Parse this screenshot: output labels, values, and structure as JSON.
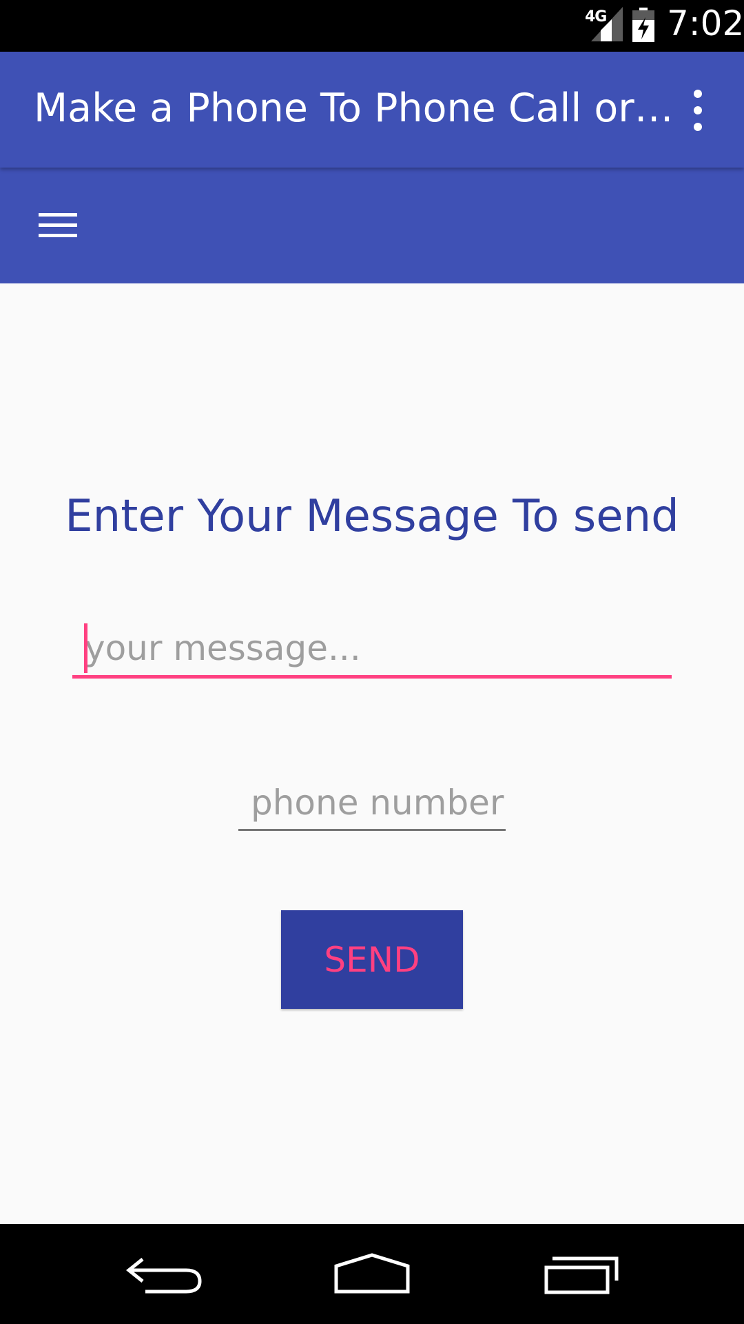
{
  "status_bar": {
    "network": "4G",
    "time": "7:02",
    "signal_icon": "signal-icon",
    "battery_icon": "battery-charging-icon"
  },
  "app_bar": {
    "title": "Make a Phone To Phone Call or…",
    "overflow_icon": "more-vert-icon"
  },
  "toolbar": {
    "menu_icon": "hamburger-menu-icon"
  },
  "content": {
    "heading": "Enter Your Message To send",
    "message_placeholder": "your message...",
    "phone_placeholder": "phone number",
    "send_label": "SEND"
  },
  "nav_bar": {
    "back_icon": "back-icon",
    "home_icon": "home-icon",
    "recents_icon": "recents-icon"
  },
  "colors": {
    "primary": "#3f51b5",
    "primary_dark": "#303f9f",
    "accent": "#ff4081",
    "background": "#fafafa"
  }
}
